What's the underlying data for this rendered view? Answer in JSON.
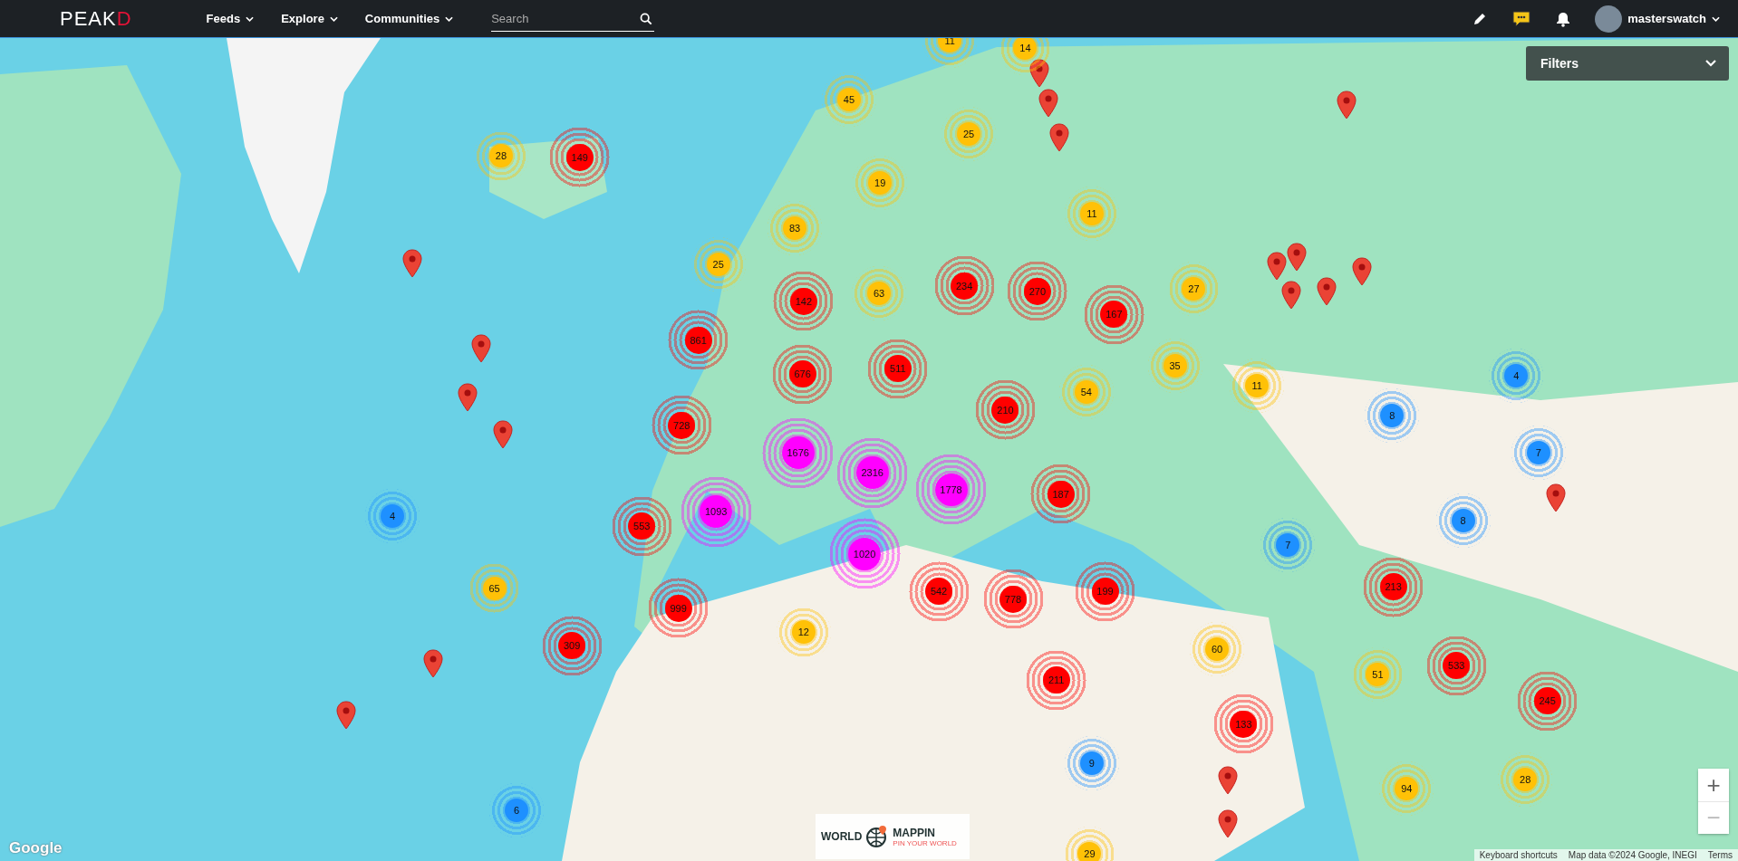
{
  "header": {
    "logo": "PEAKD",
    "nav": [
      {
        "label": "Feeds"
      },
      {
        "label": "Explore"
      },
      {
        "label": "Communities"
      }
    ],
    "search": {
      "placeholder": "Search"
    },
    "user": {
      "name": "masterswatch"
    }
  },
  "filters": {
    "label": "Filters",
    "expanded": false
  },
  "clusters": [
    {
      "count": "11",
      "color": "#ffc107"
    },
    {
      "count": "14",
      "color": "#ffc107"
    },
    {
      "count": "45",
      "color": "#ffc107"
    },
    {
      "count": "25",
      "color": "#ffc107"
    },
    {
      "count": "28",
      "color": "#ffc107"
    },
    {
      "count": "149",
      "color": "#ff0000"
    },
    {
      "count": "19",
      "color": "#ffc107"
    },
    {
      "count": "11",
      "color": "#ffc107"
    },
    {
      "count": "83",
      "color": "#ffc107"
    },
    {
      "count": "25",
      "color": "#ffc107"
    },
    {
      "count": "142",
      "color": "#ff0000"
    },
    {
      "count": "63",
      "color": "#ffc107"
    },
    {
      "count": "234",
      "color": "#ff0000"
    },
    {
      "count": "270",
      "color": "#ff0000"
    },
    {
      "count": "167",
      "color": "#ff0000"
    },
    {
      "count": "27",
      "color": "#ffc107"
    },
    {
      "count": "861",
      "color": "#ff0000"
    },
    {
      "count": "511",
      "color": "#ff0000"
    },
    {
      "count": "676",
      "color": "#ff0000"
    },
    {
      "count": "35",
      "color": "#ffc107"
    },
    {
      "count": "11",
      "color": "#ffc107"
    },
    {
      "count": "54",
      "color": "#ffc107"
    },
    {
      "count": "4",
      "color": "#1e90ff"
    },
    {
      "count": "8",
      "color": "#1e90ff"
    },
    {
      "count": "210",
      "color": "#ff0000"
    },
    {
      "count": "728",
      "color": "#ff0000"
    },
    {
      "count": "7",
      "color": "#1e90ff"
    },
    {
      "count": "1676",
      "color": "#ff00ff"
    },
    {
      "count": "2316",
      "color": "#ff00ff"
    },
    {
      "count": "1778",
      "color": "#ff00ff"
    },
    {
      "count": "187",
      "color": "#ff0000"
    },
    {
      "count": "4",
      "color": "#1e90ff"
    },
    {
      "count": "8",
      "color": "#1e90ff"
    },
    {
      "count": "553",
      "color": "#ff0000"
    },
    {
      "count": "1093",
      "color": "#ff00ff"
    },
    {
      "count": "7",
      "color": "#1e90ff"
    },
    {
      "count": "1020",
      "color": "#ff00ff"
    },
    {
      "count": "65",
      "color": "#ffc107"
    },
    {
      "count": "542",
      "color": "#ff0000"
    },
    {
      "count": "778",
      "color": "#ff0000"
    },
    {
      "count": "199",
      "color": "#ff0000"
    },
    {
      "count": "999",
      "color": "#ff0000"
    },
    {
      "count": "213",
      "color": "#ff0000"
    },
    {
      "count": "12",
      "color": "#ffc107"
    },
    {
      "count": "60",
      "color": "#ffc107"
    },
    {
      "count": "309",
      "color": "#ff0000"
    },
    {
      "count": "51",
      "color": "#ffc107"
    },
    {
      "count": "533",
      "color": "#ff0000"
    },
    {
      "count": "211",
      "color": "#ff0000"
    },
    {
      "count": "245",
      "color": "#ff0000"
    },
    {
      "count": "133",
      "color": "#ff0000"
    },
    {
      "count": "9",
      "color": "#1e90ff"
    },
    {
      "count": "94",
      "color": "#ffc107"
    },
    {
      "count": "28",
      "color": "#ffc107"
    },
    {
      "count": "6",
      "color": "#1e90ff"
    },
    {
      "count": "29",
      "color": "#ffc107"
    }
  ],
  "badge": {
    "word_1": "WORLD",
    "word_2": "MAPPIN",
    "tagline": "PIN YOUR WORLD"
  },
  "map_brand": "Google",
  "zoom": {
    "in": "+",
    "out": "−"
  },
  "attribution": [
    "Keyboard shortcuts",
    "Map data ©2024 Google, INEGI",
    "Terms"
  ]
}
